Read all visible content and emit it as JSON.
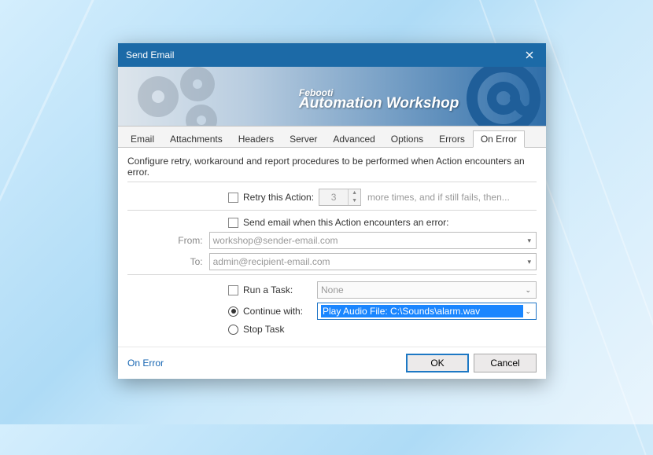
{
  "window": {
    "title": "Send Email"
  },
  "banner": {
    "brand_sub": "Febooti",
    "brand_main": "Automation Workshop"
  },
  "tabs": [
    "Email",
    "Attachments",
    "Headers",
    "Server",
    "Advanced",
    "Options",
    "Errors",
    "On Error"
  ],
  "active_tab": "On Error",
  "description": "Configure retry, workaround and report procedures to be performed when Action encounters an error.",
  "retry": {
    "label": "Retry this Action:",
    "count": "3",
    "hint": "more times, and if still fails, then..."
  },
  "email_on_error": {
    "checkbox_label": "Send email when this Action encounters an error:",
    "from_label": "From:",
    "from_value": "workshop@sender-email.com",
    "to_label": "To:",
    "to_value": "admin@recipient-email.com"
  },
  "onfail": {
    "run_task_label": "Run a Task:",
    "run_task_value": "None",
    "continue_label": "Continue with:",
    "continue_value": "Play Audio File: C:\\Sounds\\alarm.wav",
    "stop_label": "Stop Task"
  },
  "footer": {
    "help": "On Error",
    "ok": "OK",
    "cancel": "Cancel"
  }
}
